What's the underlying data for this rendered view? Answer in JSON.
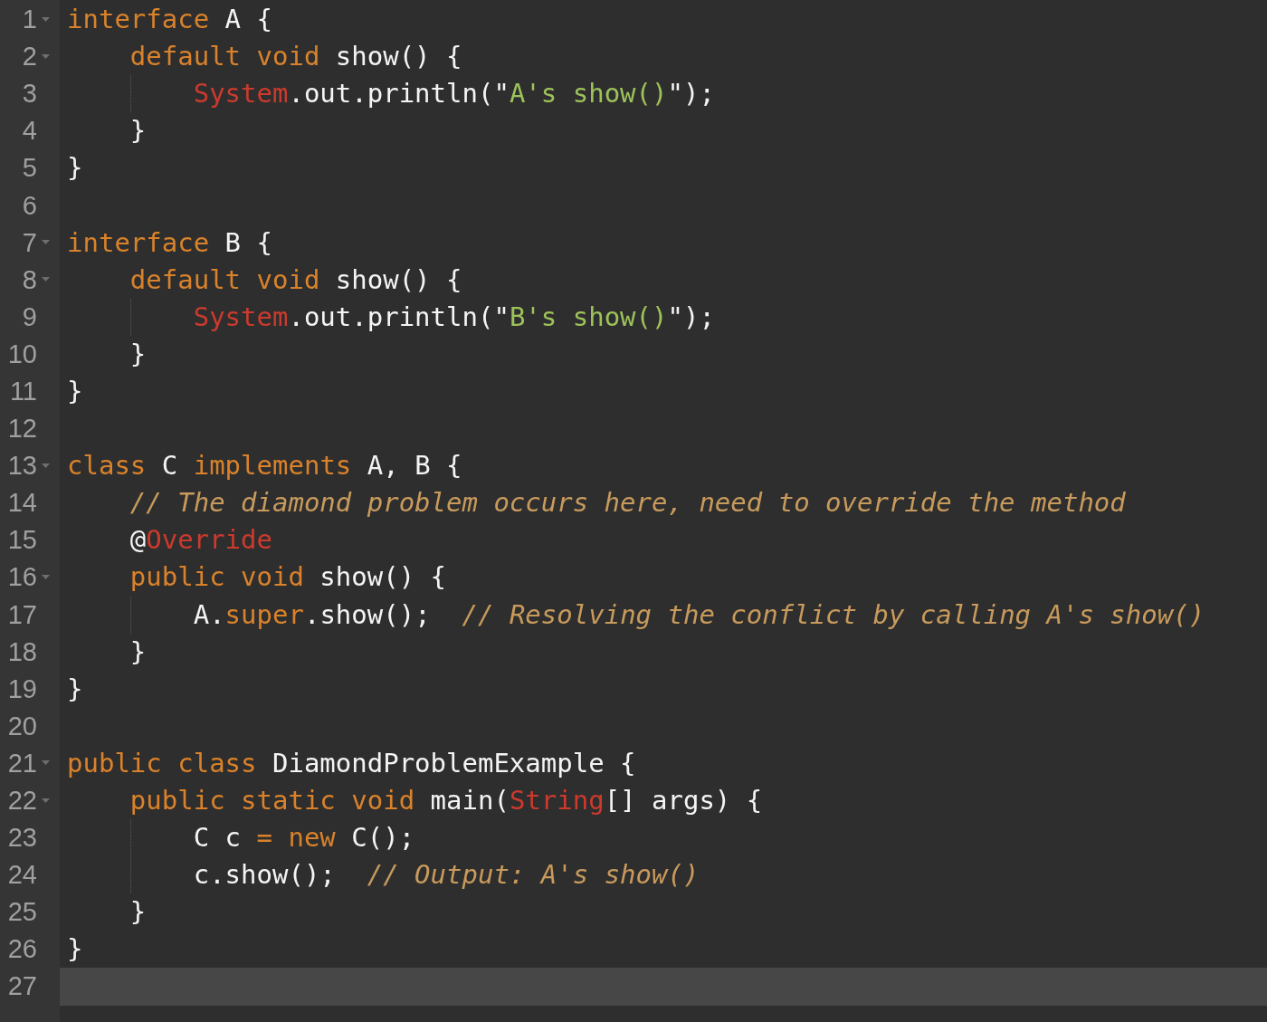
{
  "editor": {
    "lines": [
      {
        "number": "1",
        "foldable": true,
        "current": false,
        "indent_guide": false,
        "tokens": [
          {
            "kind": "kw",
            "text": "interface"
          },
          {
            "kind": "plain",
            "text": " A {"
          }
        ]
      },
      {
        "number": "2",
        "foldable": true,
        "current": false,
        "indent_guide": false,
        "tokens": [
          {
            "kind": "kw",
            "text": "    default void"
          },
          {
            "kind": "plain",
            "text": " show() {"
          }
        ]
      },
      {
        "number": "3",
        "foldable": false,
        "current": false,
        "indent_guide": true,
        "tokens": [
          {
            "kind": "type",
            "text": "        System"
          },
          {
            "kind": "plain",
            "text": ".out.println(\""
          },
          {
            "kind": "str",
            "text": "A's show()"
          },
          {
            "kind": "plain",
            "text": "\");"
          }
        ]
      },
      {
        "number": "4",
        "foldable": false,
        "current": false,
        "indent_guide": false,
        "tokens": [
          {
            "kind": "plain",
            "text": "    }"
          }
        ]
      },
      {
        "number": "5",
        "foldable": false,
        "current": false,
        "indent_guide": false,
        "tokens": [
          {
            "kind": "plain",
            "text": "}"
          }
        ]
      },
      {
        "number": "6",
        "foldable": false,
        "current": false,
        "indent_guide": false
      },
      {
        "number": "7",
        "foldable": true,
        "current": false,
        "indent_guide": false,
        "tokens": [
          {
            "kind": "kw",
            "text": "interface"
          },
          {
            "kind": "plain",
            "text": " B {"
          }
        ]
      },
      {
        "number": "8",
        "foldable": true,
        "current": false,
        "indent_guide": false,
        "tokens": [
          {
            "kind": "kw",
            "text": "    default void"
          },
          {
            "kind": "plain",
            "text": " show() {"
          }
        ]
      },
      {
        "number": "9",
        "foldable": false,
        "current": false,
        "indent_guide": true,
        "tokens": [
          {
            "kind": "type",
            "text": "        System"
          },
          {
            "kind": "plain",
            "text": ".out.println(\""
          },
          {
            "kind": "str",
            "text": "B's show()"
          },
          {
            "kind": "plain",
            "text": "\");"
          }
        ]
      },
      {
        "number": "10",
        "foldable": false,
        "current": false,
        "indent_guide": false,
        "tokens": [
          {
            "kind": "plain",
            "text": "    }"
          }
        ]
      },
      {
        "number": "11",
        "foldable": false,
        "current": false,
        "indent_guide": false,
        "tokens": [
          {
            "kind": "plain",
            "text": "}"
          }
        ]
      },
      {
        "number": "12",
        "foldable": false,
        "current": false,
        "indent_guide": false
      },
      {
        "number": "13",
        "foldable": true,
        "current": false,
        "indent_guide": false,
        "tokens": [
          {
            "kind": "kw",
            "text": "class"
          },
          {
            "kind": "plain",
            "text": " C "
          },
          {
            "kind": "kw",
            "text": "implements"
          },
          {
            "kind": "plain",
            "text": " A, B {"
          }
        ]
      },
      {
        "number": "14",
        "foldable": false,
        "current": false,
        "indent_guide": false,
        "tokens": [
          {
            "kind": "comment",
            "text": "    // The diamond problem occurs here, need to override the method"
          }
        ]
      },
      {
        "number": "15",
        "foldable": false,
        "current": false,
        "indent_guide": false,
        "tokens": [
          {
            "kind": "plain",
            "text": "    @"
          },
          {
            "kind": "type",
            "text": "Override"
          }
        ]
      },
      {
        "number": "16",
        "foldable": true,
        "current": false,
        "indent_guide": false,
        "tokens": [
          {
            "kind": "kw",
            "text": "    public void"
          },
          {
            "kind": "plain",
            "text": " show() {"
          }
        ]
      },
      {
        "number": "17",
        "foldable": false,
        "current": false,
        "indent_guide": true,
        "tokens": [
          {
            "kind": "plain",
            "text": "        A."
          },
          {
            "kind": "kw",
            "text": "super"
          },
          {
            "kind": "plain",
            "text": ".show();  "
          },
          {
            "kind": "comment",
            "text": "// Resolving the conflict by calling A's show()"
          }
        ]
      },
      {
        "number": "18",
        "foldable": false,
        "current": false,
        "indent_guide": false,
        "tokens": [
          {
            "kind": "plain",
            "text": "    }"
          }
        ]
      },
      {
        "number": "19",
        "foldable": false,
        "current": false,
        "indent_guide": false,
        "tokens": [
          {
            "kind": "plain",
            "text": "}"
          }
        ]
      },
      {
        "number": "20",
        "foldable": false,
        "current": false,
        "indent_guide": false
      },
      {
        "number": "21",
        "foldable": true,
        "current": false,
        "indent_guide": false,
        "tokens": [
          {
            "kind": "kw",
            "text": "public class"
          },
          {
            "kind": "plain",
            "text": " DiamondProblemExample {"
          }
        ]
      },
      {
        "number": "22",
        "foldable": true,
        "current": false,
        "indent_guide": false,
        "tokens": [
          {
            "kind": "kw",
            "text": "    public static void"
          },
          {
            "kind": "plain",
            "text": " main("
          },
          {
            "kind": "type",
            "text": "String"
          },
          {
            "kind": "plain",
            "text": "[] args) {"
          }
        ]
      },
      {
        "number": "23",
        "foldable": false,
        "current": false,
        "indent_guide": true,
        "tokens": [
          {
            "kind": "plain",
            "text": "        C c "
          },
          {
            "kind": "kw",
            "text": "="
          },
          {
            "kind": "kw",
            "text": " new"
          },
          {
            "kind": "plain",
            "text": " C();"
          }
        ]
      },
      {
        "number": "24",
        "foldable": false,
        "current": false,
        "indent_guide": true,
        "tokens": [
          {
            "kind": "plain",
            "text": "        c.show();  "
          },
          {
            "kind": "comment",
            "text": "// Output: A's show()"
          }
        ]
      },
      {
        "number": "25",
        "foldable": false,
        "current": false,
        "indent_guide": false,
        "tokens": [
          {
            "kind": "plain",
            "text": "    }"
          }
        ]
      },
      {
        "number": "26",
        "foldable": false,
        "current": false,
        "indent_guide": false,
        "tokens": [
          {
            "kind": "plain",
            "text": "}"
          }
        ]
      },
      {
        "number": "27",
        "foldable": false,
        "current": true,
        "indent_guide": false
      }
    ]
  }
}
